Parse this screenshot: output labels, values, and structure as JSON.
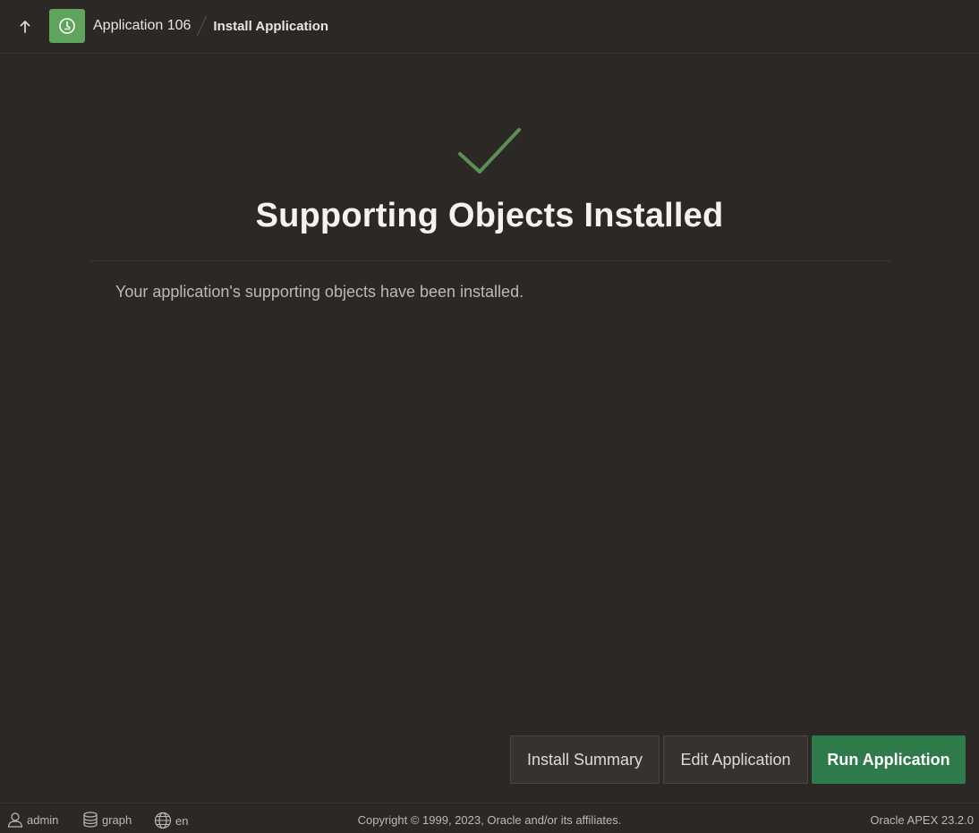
{
  "header": {
    "breadcrumb": {
      "app_label": "Application 106",
      "current_label": "Install Application"
    },
    "app_icon_color": "#5fa35d",
    "icons": {
      "up": "arrow-up-icon",
      "app": "app-badge-icon"
    }
  },
  "main": {
    "title": "Supporting Objects Installed",
    "message": "Your application's supporting objects have been installed.",
    "success_icon": "checkmark-icon",
    "success_color": "#5b8f55"
  },
  "actions": {
    "install_summary_label": "Install Summary",
    "edit_application_label": "Edit Application",
    "run_application_label": "Run Application",
    "primary_color": "#2f7a4b"
  },
  "footer": {
    "user": "admin",
    "schema": "graph",
    "language": "en",
    "copyright": "Copyright © 1999, 2023, Oracle and/or its affiliates.",
    "version": "Oracle APEX 23.2.0",
    "icons": {
      "user": "user-icon",
      "schema": "database-icon",
      "language": "globe-icon"
    }
  }
}
